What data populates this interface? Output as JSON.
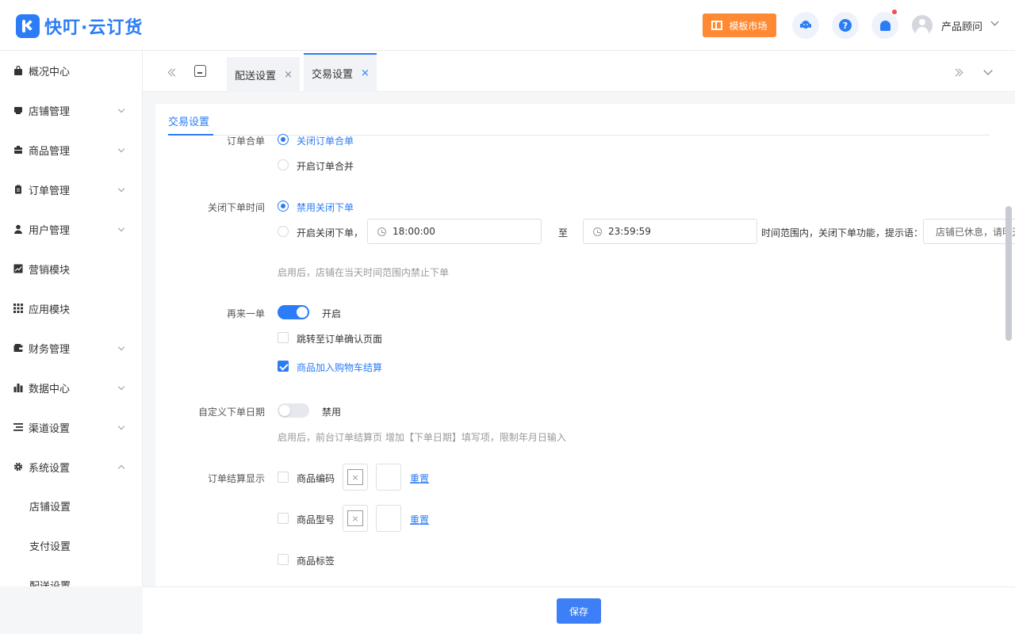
{
  "header": {
    "logo_text": "快叮·云订货",
    "template_market": "模板市场",
    "help_glyph": "?",
    "user_name": "产品顾问",
    "colors": {
      "brand": "#2b7cf6",
      "template_button": "#ff8a33",
      "notification_dot": "#f5484d"
    }
  },
  "sidebar": {
    "items": [
      {
        "label": "概况中心",
        "icon": "bag-icon"
      },
      {
        "label": "店铺管理",
        "icon": "store-icon"
      },
      {
        "label": "商品管理",
        "icon": "box-icon"
      },
      {
        "label": "订单管理",
        "icon": "clipboard-icon"
      },
      {
        "label": "用户管理",
        "icon": "user-icon"
      },
      {
        "label": "营销模块",
        "icon": "chart-icon"
      },
      {
        "label": "应用模块",
        "icon": "grid-icon"
      },
      {
        "label": "财务管理",
        "icon": "wallet-icon"
      },
      {
        "label": "数据中心",
        "icon": "bar-chart-icon"
      },
      {
        "label": "渠道设置",
        "icon": "list-icon"
      },
      {
        "label": "系统设置",
        "icon": "gear-icon"
      }
    ],
    "sub_items": [
      {
        "label": "店铺设置"
      },
      {
        "label": "支付设置"
      },
      {
        "label": "配送设置"
      }
    ]
  },
  "tabs": {
    "items": [
      {
        "label": "配送设置",
        "close": "×"
      },
      {
        "label": "交易设置",
        "close": "×"
      }
    ]
  },
  "section_tab": "交易设置",
  "form": {
    "order_merge": {
      "label": "订单合单",
      "options": [
        "关闭订单合单",
        "开启订单合并"
      ],
      "selected": "关闭订单合单"
    },
    "close_order_time": {
      "label": "关闭下单时间",
      "option_disable": "禁用关闭下单",
      "option_enable": "开启关闭下单，",
      "start_time": "18:00:00",
      "to_label": "至",
      "end_time": "23:59:59",
      "suffix": "时间范围内，关闭下单功能，提示语：",
      "prompt_value": "店铺已休息，请明天",
      "hint": "启用后，店铺在当天时间范围内禁止下单",
      "selected": "禁用关闭下单"
    },
    "reorder": {
      "label": "再来一单",
      "switch_on": true,
      "switch_text": "开启",
      "options": [
        {
          "label": "跳转至订单确认页面",
          "checked": false
        },
        {
          "label": "商品加入购物车结算",
          "checked": true
        }
      ]
    },
    "custom_date": {
      "label": "自定义下单日期",
      "switch_on": false,
      "switch_text": "禁用",
      "hint": "启用后，前台订单结算页 增加【下单日期】填写项，限制年月日输入"
    },
    "checkout_display": {
      "label": "订单结算显示",
      "rows": [
        {
          "label": "商品编码",
          "checked": false,
          "reset": "重置",
          "img_glyph": "×"
        },
        {
          "label": "商品型号",
          "checked": false,
          "reset": "重置",
          "img_glyph": "×"
        },
        {
          "label": "商品标签",
          "checked": false
        }
      ]
    }
  },
  "footer": {
    "save_label": "保存"
  }
}
